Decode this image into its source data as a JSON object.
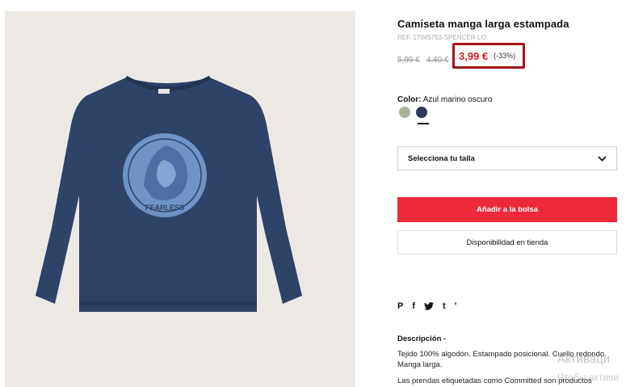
{
  "product": {
    "title": "Camiseta manga larga estampada",
    "ref": "REF. 17045753-SPENCER-LO",
    "prices": {
      "original": "5,99 €",
      "previous": "4,49 €",
      "current": "3,99 €",
      "discount": "(-33%)"
    },
    "image": {
      "print_text": "FEARLESS",
      "colors": {
        "background": "#ece9e5",
        "shirt": "#2f4268",
        "print": "#6f93c7"
      }
    }
  },
  "color": {
    "label": "Color:",
    "value": "Azul marino oscuro",
    "swatches": [
      {
        "name": "green",
        "hex": "#a6b394",
        "selected": false
      },
      {
        "name": "navy",
        "hex": "#2c3a58",
        "selected": true
      }
    ]
  },
  "size_select": {
    "label": "Selecciona tu talla",
    "icon": "chevron-down-icon"
  },
  "add_button": {
    "label": "Añadir a la bolsa",
    "color": "#ec2a3b"
  },
  "store_button": {
    "label": "Disponibilidad en tienda"
  },
  "social": {
    "pinterest": "P",
    "facebook": "f",
    "twitter": "t",
    "tumblr": "t",
    "extra": "'"
  },
  "description": {
    "title": "Descripción  -",
    "text": "Tejido 100% algodón. Estampado posicional. Cuello redondo. Manga larga.",
    "label_text": "Las prendas etiquetadas como Committed son productos"
  },
  "watermark": {
    "line1": "Активаци",
    "line2": "Чтобы активи"
  }
}
